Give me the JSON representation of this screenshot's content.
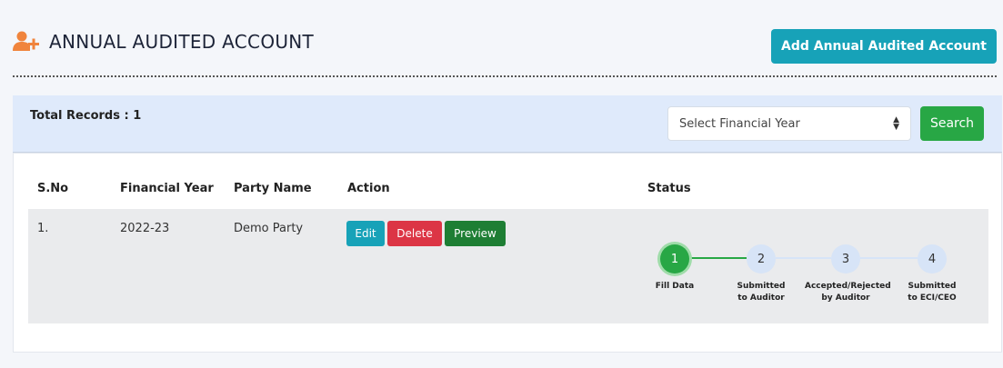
{
  "header": {
    "title": "ANNUAL AUDITED ACCOUNT",
    "icon": "user-plus-icon",
    "add_button": "Add Annual Audited Account",
    "accent_color": "#17a2b8",
    "icon_color": "#f0843c"
  },
  "filter": {
    "total_label": "Total Records : 1",
    "select_value": "Select Financial Year",
    "search_button": "Search"
  },
  "table": {
    "columns": [
      "S.No",
      "Financial Year",
      "Party Name",
      "Action",
      "Status"
    ],
    "rows": [
      {
        "sno": "1.",
        "financial_year": "2022-23",
        "party_name": "Demo Party",
        "actions": [
          "Edit",
          "Delete",
          "Preview"
        ],
        "status_steps": [
          {
            "number": "1",
            "label_line1": "Fill Data",
            "label_line2": "",
            "state": "done"
          },
          {
            "number": "2",
            "label_line1": "Submitted",
            "label_line2": "to Auditor",
            "state": "todo"
          },
          {
            "number": "3",
            "label_line1": "Accepted/Rejected",
            "label_line2": "by Auditor",
            "state": "todo"
          },
          {
            "number": "4",
            "label_line1": "Submitted",
            "label_line2": "to ECI/CEO",
            "state": "todo"
          }
        ]
      }
    ]
  }
}
